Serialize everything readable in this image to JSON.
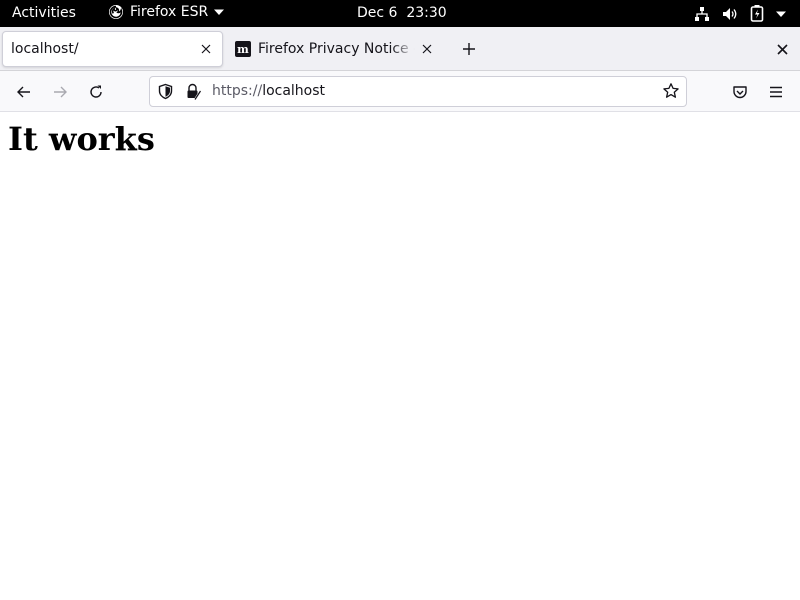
{
  "topbar": {
    "activities_label": "Activities",
    "app_name": "Firefox ESR",
    "clock": "Dec 6  23:30"
  },
  "tabs": [
    {
      "title": "localhost/",
      "active": true
    },
    {
      "title": "Firefox Privacy Notice — Mozilla",
      "active": false,
      "favicon_text": "m"
    }
  ],
  "navbar": {
    "url_scheme": "https://",
    "url_host": "localhost"
  },
  "page": {
    "heading": "It works"
  },
  "colors": {
    "topbar_bg": "#000000",
    "tabstrip_bg": "#f0f0f4",
    "navbar_bg": "#f9f9fb",
    "text": "#15141a"
  },
  "icons": {
    "app": "firefox-icon",
    "network": "network-icon",
    "volume": "volume-icon",
    "battery": "battery-icon",
    "back": "back-arrow-icon",
    "forward": "forward-arrow-icon",
    "reload": "reload-icon",
    "shield": "tracking-protection-shield-icon",
    "lock": "lock-icon",
    "star": "bookmark-star-icon",
    "pocket": "pocket-icon",
    "menu": "hamburger-menu-icon"
  }
}
